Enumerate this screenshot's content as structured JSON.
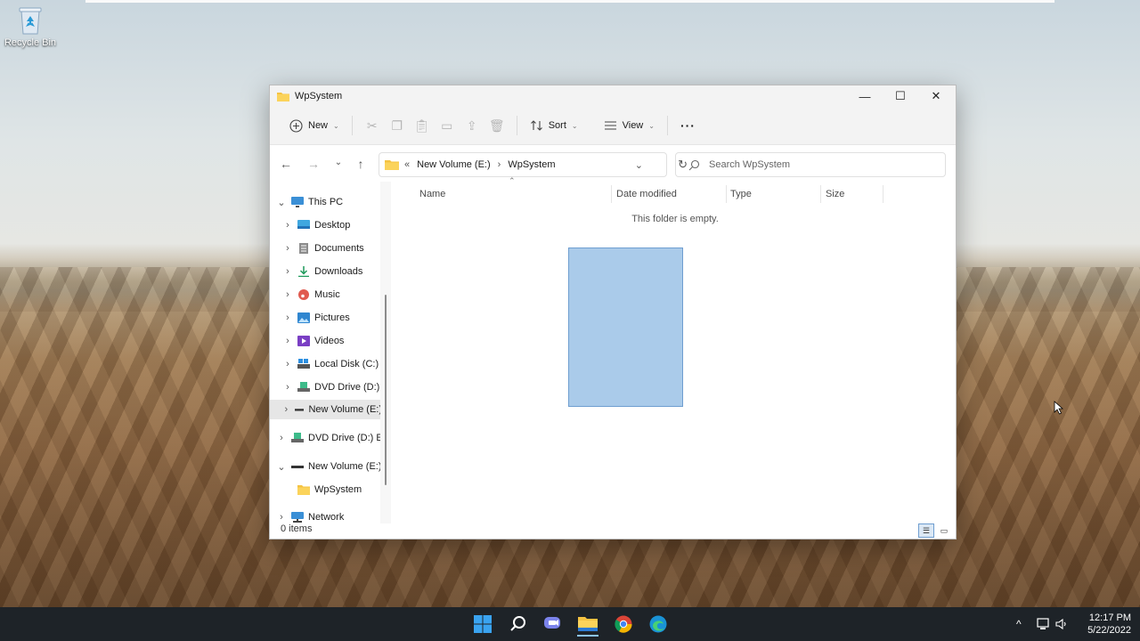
{
  "desktop": {
    "recycle_bin_label": "Recycle Bin"
  },
  "window": {
    "title": "WpSystem",
    "controls": {
      "minimize": "—",
      "maximize": "☐",
      "close": "✕"
    }
  },
  "toolbar": {
    "new_label": "New",
    "sort_label": "Sort",
    "view_label": "View",
    "more_label": "···"
  },
  "address": {
    "chevrons": "«",
    "crumb1": "New Volume (E:)",
    "separator": "›",
    "crumb2": "WpSystem"
  },
  "search": {
    "placeholder": "Search WpSystem"
  },
  "sidebar": {
    "items": [
      {
        "label": "This PC"
      },
      {
        "label": "Desktop"
      },
      {
        "label": "Documents"
      },
      {
        "label": "Downloads"
      },
      {
        "label": "Music"
      },
      {
        "label": "Pictures"
      },
      {
        "label": "Videos"
      },
      {
        "label": "Local Disk (C:)"
      },
      {
        "label": "DVD Drive (D:) ESD"
      },
      {
        "label": "New Volume (E:)"
      },
      {
        "label": "DVD Drive (D:) ESD"
      },
      {
        "label": "New Volume (E:)"
      },
      {
        "label": "WpSystem"
      },
      {
        "label": "Network"
      }
    ]
  },
  "columns": {
    "name": "Name",
    "date_modified": "Date modified",
    "type": "Type",
    "size": "Size"
  },
  "content": {
    "empty_message": "This folder is empty."
  },
  "status": {
    "items_count": "0 items"
  },
  "taskbar": {
    "time": "12:17 PM",
    "date": "5/22/2022"
  },
  "colors": {
    "accent": "#0067c0",
    "folder": "#f5c342",
    "selection": "#aacbea",
    "taskbar": "#1e2328"
  }
}
